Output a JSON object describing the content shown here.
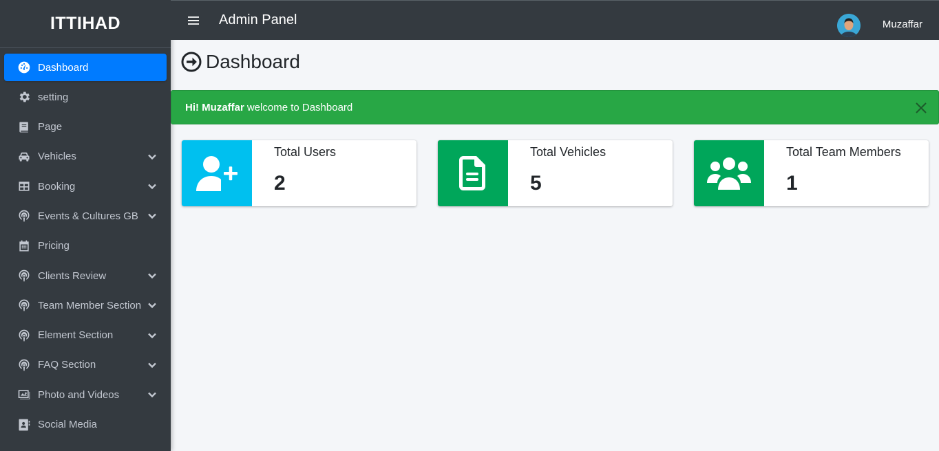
{
  "brand": "ITTIHAD",
  "header": {
    "title": "Admin Panel",
    "user_name": "Muzaffar"
  },
  "sidebar": {
    "items": [
      {
        "label": "Dashboard",
        "icon": "tachometer-icon",
        "active": true,
        "has_children": false
      },
      {
        "label": "setting",
        "icon": "gear-icon",
        "active": false,
        "has_children": false
      },
      {
        "label": "Page",
        "icon": "book-icon",
        "active": false,
        "has_children": false
      },
      {
        "label": "Vehicles",
        "icon": "car-icon",
        "active": false,
        "has_children": true
      },
      {
        "label": "Booking",
        "icon": "table-icon",
        "active": false,
        "has_children": true
      },
      {
        "label": "Events & Cultures GB",
        "icon": "podcast-icon",
        "active": false,
        "has_children": true
      },
      {
        "label": "Pricing",
        "icon": "calendar-icon",
        "active": false,
        "has_children": false
      },
      {
        "label": "Clients Review",
        "icon": "podcast-icon",
        "active": false,
        "has_children": true
      },
      {
        "label": "Team Member Section",
        "icon": "podcast-icon",
        "active": false,
        "has_children": true
      },
      {
        "label": "Element Section",
        "icon": "podcast-icon",
        "active": false,
        "has_children": true
      },
      {
        "label": "FAQ Section",
        "icon": "podcast-icon",
        "active": false,
        "has_children": true
      },
      {
        "label": "Photo and Videos",
        "icon": "image-icon",
        "active": false,
        "has_children": true
      },
      {
        "label": "Social Media",
        "icon": "address-book-icon",
        "active": false,
        "has_children": false
      }
    ]
  },
  "main": {
    "page_title": "Dashboard",
    "alert": {
      "greeting": "Hi! Muzaffar",
      "message": "welcome to Dashboard"
    },
    "cards": [
      {
        "label": "Total Users",
        "value": "2",
        "icon": "user-plus-icon",
        "color": "#00c0ef"
      },
      {
        "label": "Total Vehicles",
        "value": "5",
        "icon": "file-icon",
        "color": "#00a65a"
      },
      {
        "label": "Total Team Members",
        "value": "1",
        "icon": "users-icon",
        "color": "#00a65a"
      }
    ]
  },
  "colors": {
    "sidebar": "#343a40",
    "active": "#007bff",
    "alert": "#28a745"
  }
}
